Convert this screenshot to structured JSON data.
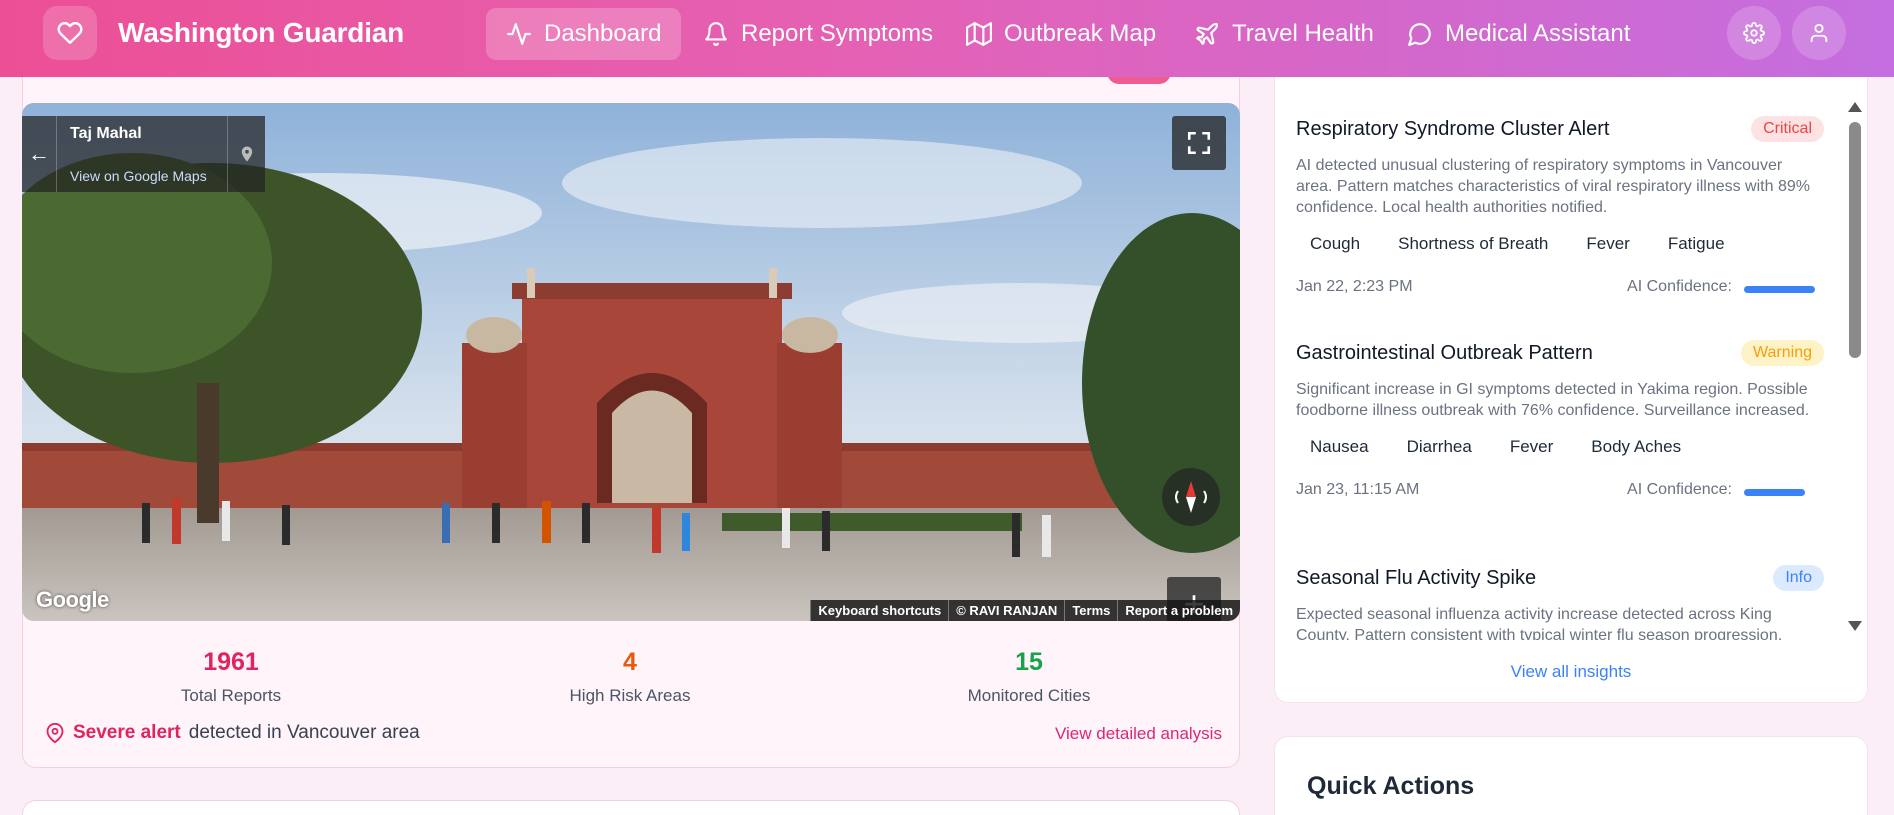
{
  "app": {
    "brand": "Washington Guardian",
    "icons": {
      "logo": "heart-icon",
      "settings": "gear-icon",
      "profile": "user-icon"
    }
  },
  "nav": {
    "items": [
      {
        "label": "Dashboard",
        "icon": "activity-icon",
        "active": true
      },
      {
        "label": "Report Symptoms",
        "icon": "bell-icon",
        "active": false
      },
      {
        "label": "Outbreak Map",
        "icon": "map-icon",
        "active": false
      },
      {
        "label": "Travel Health",
        "icon": "plane-icon",
        "active": false
      },
      {
        "label": "Medical Assistant",
        "icon": "chat-icon",
        "active": false
      }
    ]
  },
  "streetview": {
    "place": "Taj Mahal",
    "link": "View on Google Maps",
    "logo": "Google",
    "attribution": [
      "Keyboard shortcuts",
      "© RAVI RANJAN",
      "Terms",
      "Report a problem"
    ],
    "zoom_in": "+",
    "zoom_out": "−"
  },
  "stats": [
    {
      "value": "1961",
      "label": "Total Reports",
      "color": "#e0245e"
    },
    {
      "value": "4",
      "label": "High Risk Areas",
      "color": "#ea580c"
    },
    {
      "value": "15",
      "label": "Monitored Cities",
      "color": "#16a34a"
    }
  ],
  "alert": {
    "severity": "Severe alert",
    "text": "detected in Vancouver area",
    "link": "View detailed analysis"
  },
  "insights": {
    "items": [
      {
        "title": "Respiratory Syndrome Cluster Alert",
        "badge": "Critical",
        "badge_color": "#ef4444",
        "badge_bg": "#fde2e4",
        "description": "AI detected unusual clustering of respiratory symptoms in Vancouver area. Pattern matches characteristics of viral respiratory illness with 89% confidence. Local health authorities notified.",
        "tags": [
          "Cough",
          "Shortness of Breath",
          "Fever",
          "Fatigue"
        ],
        "time": "Jan 22, 2:23 PM",
        "confidence_label": "AI Confidence:",
        "confidence": 0.89
      },
      {
        "title": "Gastrointestinal Outbreak Pattern",
        "badge": "Warning",
        "badge_color": "#f59e0b",
        "badge_bg": "#fef3c7",
        "description": "Significant increase in GI symptoms detected in Yakima region. Possible foodborne illness outbreak with 76% confidence. Surveillance increased.",
        "tags": [
          "Nausea",
          "Diarrhea",
          "Fever",
          "Body Aches"
        ],
        "time": "Jan 23, 11:15 AM",
        "confidence_label": "AI Confidence:",
        "confidence": 0.76
      },
      {
        "title": "Seasonal Flu Activity Spike",
        "badge": "Info",
        "badge_color": "#3b82f6",
        "badge_bg": "#dbeafe",
        "description": "Expected seasonal influenza activity increase detected across King County. Pattern consistent with typical winter flu season progression."
      }
    ],
    "view_all": "View all insights"
  },
  "quick_actions": {
    "title": "Quick Actions"
  }
}
